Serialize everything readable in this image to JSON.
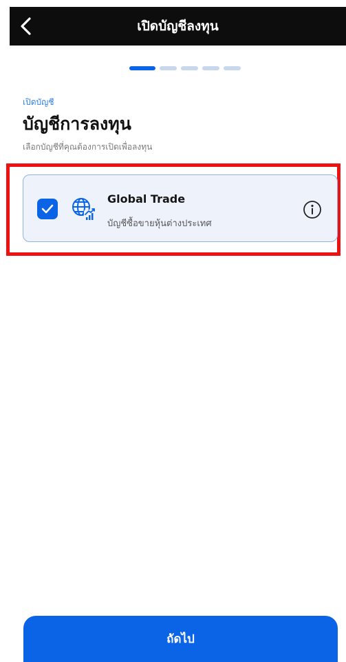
{
  "header": {
    "title": "เปิดบัญชีลงทุน",
    "back_icon": "chevron-left-icon"
  },
  "stepper": {
    "total_steps": 5,
    "current_step": 1
  },
  "page": {
    "kicker": "เปิดบัญชี",
    "heading": "บัญชีการลงทุน",
    "subheading": "เลือกบัญชีที่คุณต้องการเปิดเพื่อลงทุน"
  },
  "accounts": [
    {
      "title": "Global Trade",
      "subtitle": "บัญชีซื้อขายหุ้นต่างประเทศ",
      "checked": true,
      "icon": "globe-chart-icon",
      "info_icon": "info-icon"
    }
  ],
  "footer": {
    "next_label": "ถัดไป"
  },
  "colors": {
    "primary": "#0b63e5",
    "card_bg": "#eef3fb",
    "card_border": "#8fb3e3",
    "highlight": "#ee1111",
    "topbar": "#0d0d0d"
  }
}
